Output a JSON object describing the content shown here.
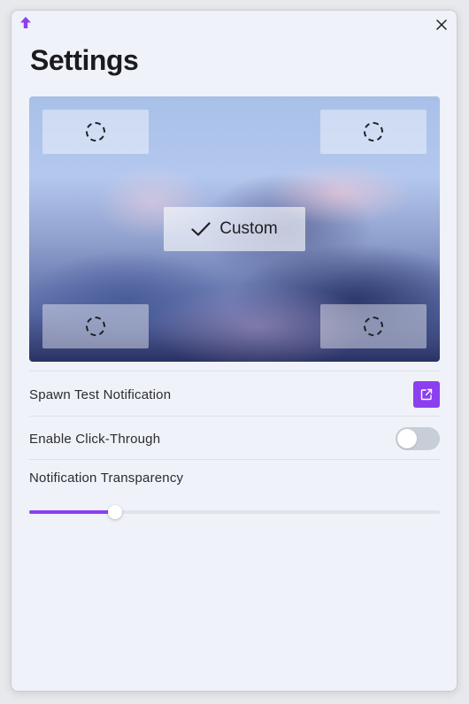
{
  "window": {
    "app_icon": "arrow-up-icon",
    "close_icon": "close-icon"
  },
  "page": {
    "title": "Settings"
  },
  "position_picker": {
    "corner_icon": "dashed-circle-icon",
    "selected_icon": "checkmark-icon",
    "selected_label": "Custom"
  },
  "settings": {
    "spawn_test_label": "Spawn Test Notification",
    "spawn_test_icon": "external-link-icon",
    "click_through_label": "Enable Click-Through",
    "click_through_enabled": false,
    "transparency_label": "Notification Transparency",
    "transparency_value": 0.21
  },
  "colors": {
    "accent": "#8c3ff0",
    "background": "#eff2f8",
    "toggle_off": "#c8ced8"
  }
}
